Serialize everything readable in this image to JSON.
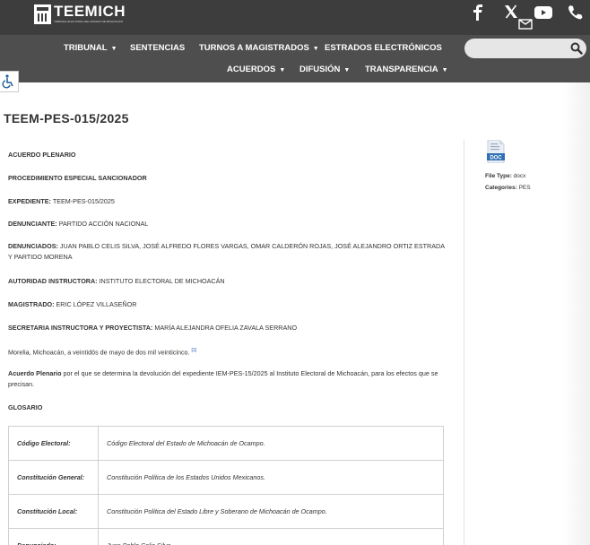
{
  "header": {
    "logo_text": "TEEMICH",
    "logo_subtext": "TRIBUNAL ELECTORAL DEL ESTADO DE MICHOACÁN",
    "social_icons": [
      "facebook-icon",
      "x-icon",
      "youtube-icon",
      "phone-icon",
      "mail-icon"
    ]
  },
  "nav": {
    "row1": [
      {
        "label": "TRIBUNAL",
        "dropdown": true
      },
      {
        "label": "SENTENCIAS",
        "dropdown": false
      },
      {
        "label": "TURNOS A MAGISTRADOS",
        "dropdown": true
      },
      {
        "label": "ESTRADOS ELECTRÓNICOS",
        "dropdown": false
      }
    ],
    "row2": [
      {
        "label": "ACUERDOS",
        "dropdown": true
      },
      {
        "label": "DIFUSIÓN",
        "dropdown": true
      },
      {
        "label": "TRANSPARENCIA",
        "dropdown": true
      }
    ],
    "search_placeholder": ""
  },
  "page": {
    "title": "TEEM-PES-015/2025"
  },
  "content": {
    "p1": "ACUERDO PLENARIO",
    "p2": "PROCEDIMIENTO ESPECIAL SANCIONADOR",
    "expediente_label": "EXPEDIENTE:",
    "expediente_value": "TEEM-PES-015/2025",
    "denunciante_label": "DENUNCIANTE:",
    "denunciante_value": "PARTIDO ACCIÓN NACIONAL",
    "denunciados_label": "DENUNCIADOS:",
    "denunciados_value": "JUAN PABLO CELIS SILVA, JOSÉ ALFREDO FLORES VARGAS, OMAR CALDERÓN ROJAS, JOSÉ ALEJANDRO ORTIZ ESTRADA Y PARTIDO MORENA",
    "autoridad_label": "AUTORIDAD INSTRUCTORA:",
    "autoridad_value": "INSTITUTO ELECTORAL DE MICHOACÁN",
    "magistrado_label": "MAGISTRADO:",
    "magistrado_value": "ERIC LÓPEZ VILLASEÑOR",
    "secretaria_label": "SECRETARIA INSTRUCTORA Y PROYECTISTA:",
    "secretaria_value": "MARÍA ALEJANDRA OFELIA ZAVALA SERRANO",
    "fecha": "Morelia, Michoacán, a veintidós de mayo de dos mil veinticinco.",
    "fecha_footnote": "[1]",
    "acuerdo_label": "Acuerdo Plenario",
    "acuerdo_text": "por el que se determina la devolución del expediente IEM-PES-15/2025 al Instituto Electoral de Michoacán, para los efectos que se precisan.",
    "glosario_heading": "GLOSARIO"
  },
  "glossary": [
    {
      "term": "Código Electoral:",
      "definition": "Código Electoral del Estado de Michoacán de Ocampo."
    },
    {
      "term": "Constitución General:",
      "definition": "Constitución Política de los Estados Unidos Mexicanos."
    },
    {
      "term": "Constitución Local:",
      "definition": "Constitución Política del Estado Libre y Soberano de Michoacán de Ocampo."
    },
    {
      "term": "Denunciado:",
      "definition": "Juan Pablo Celis Silva."
    }
  ],
  "sidebar": {
    "doc_icon_label": "DOC",
    "file_type_label": "File Type:",
    "file_type_value": "docx",
    "categories_label": "Categories:",
    "categories_value": "PES"
  },
  "colors": {
    "header_bg": "#3d3d3d",
    "nav_bg": "#4e4e4e",
    "doc_blue": "#2f6fb5"
  }
}
